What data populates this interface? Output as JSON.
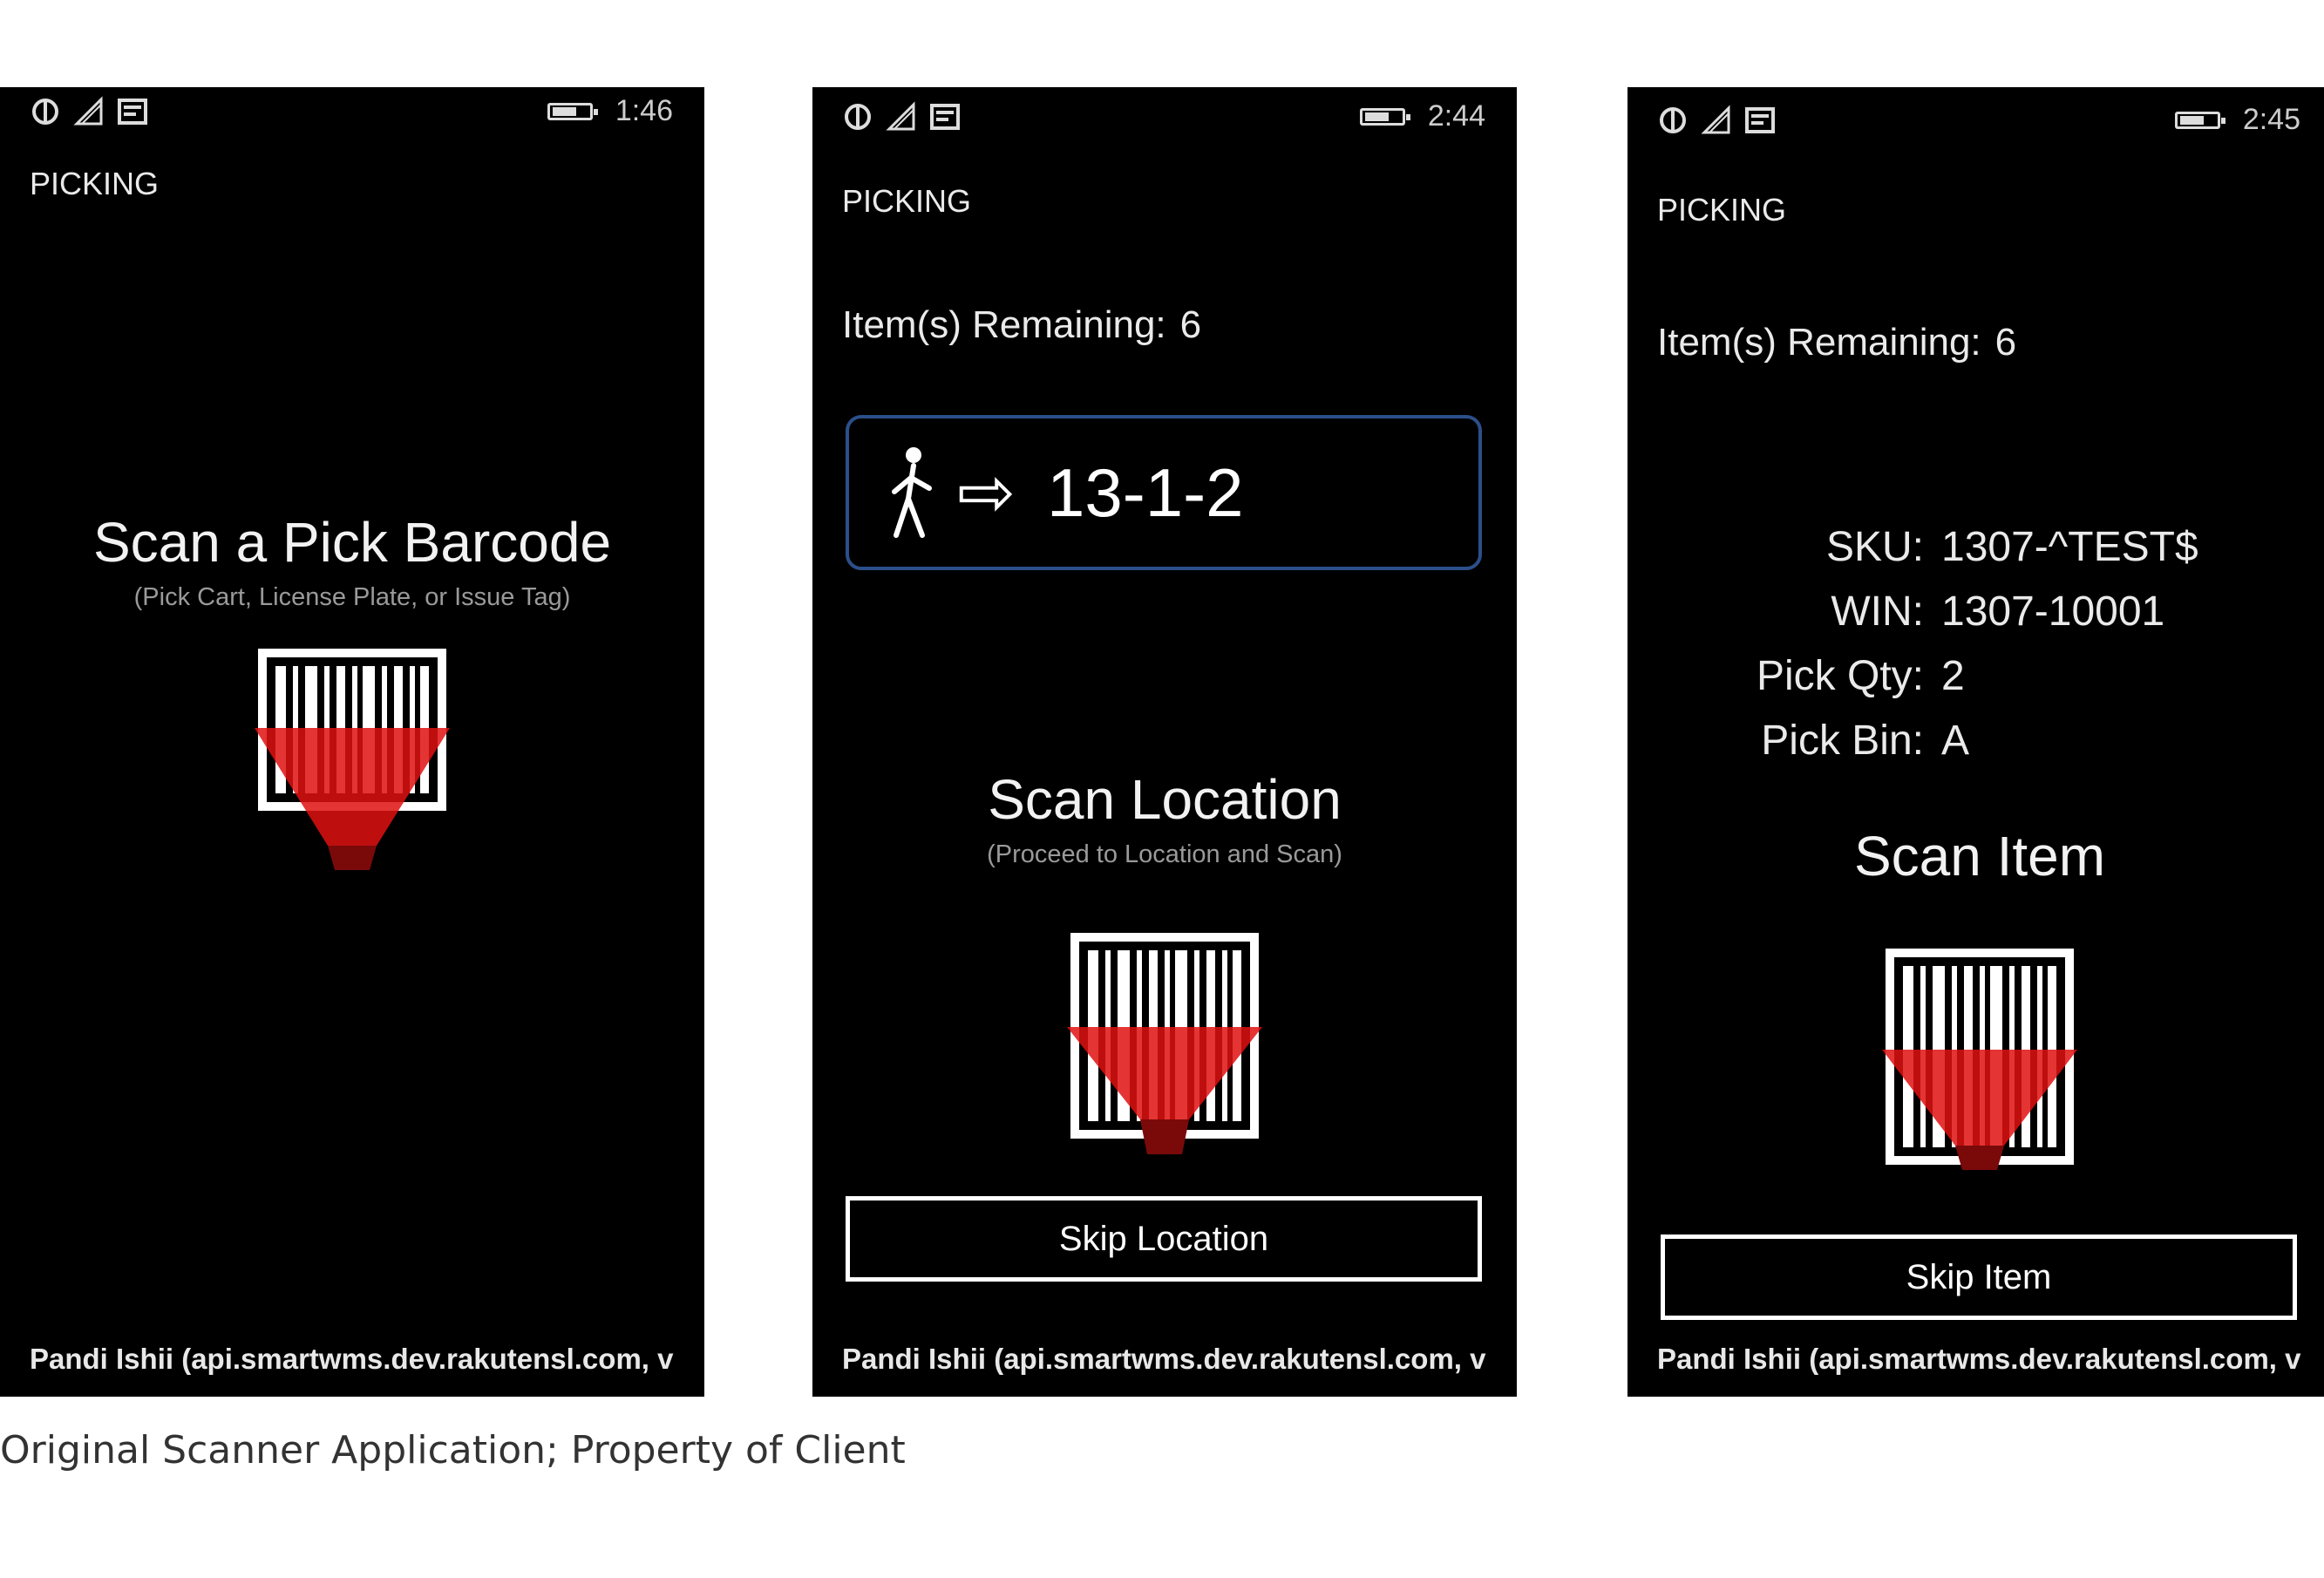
{
  "screens": [
    {
      "clock": "1:46",
      "app_title": "PICKING",
      "scan_title": "Scan a Pick Barcode",
      "scan_subtitle": "(Pick Cart, License Plate, or Issue Tag)",
      "footer": "Pandi Ishii (api.smartwms.dev.rakutensl.com, v"
    },
    {
      "clock": "2:44",
      "app_title": "PICKING",
      "remaining_label": "Item(s) Remaining:",
      "remaining_value": "6",
      "location_arrow": "⇨",
      "location": "13-1-2",
      "scan_title": "Scan Location",
      "scan_subtitle": "(Proceed to Location and Scan)",
      "skip_label": "Skip Location",
      "footer": "Pandi Ishii (api.smartwms.dev.rakutensl.com, v"
    },
    {
      "clock": "2:45",
      "app_title": "PICKING",
      "remaining_label": "Item(s) Remaining:",
      "remaining_value": "6",
      "details": [
        {
          "label": "SKU:",
          "value": "1307-^TEST$"
        },
        {
          "label": "WIN:",
          "value": "1307-10001"
        },
        {
          "label": "Pick Qty:",
          "value": "2"
        },
        {
          "label": "Pick Bin:",
          "value": "A"
        }
      ],
      "scan_title": "Scan Item",
      "skip_label": "Skip Item",
      "footer": "Pandi Ishii (api.smartwms.dev.rakutensl.com, v"
    }
  ],
  "icons": {
    "status": [
      "data-sync-icon",
      "signal-icon",
      "message-icon",
      "battery-icon"
    ],
    "scan": "barcode-scan-icon",
    "walk": "walking-person-icon",
    "arrow": "arrow-right-icon"
  },
  "colors": {
    "screen_bg": "#000000",
    "scan_red": "#e01010",
    "location_border": "#2b4f8a"
  },
  "caption": "Original Scanner Application; Property of Client"
}
